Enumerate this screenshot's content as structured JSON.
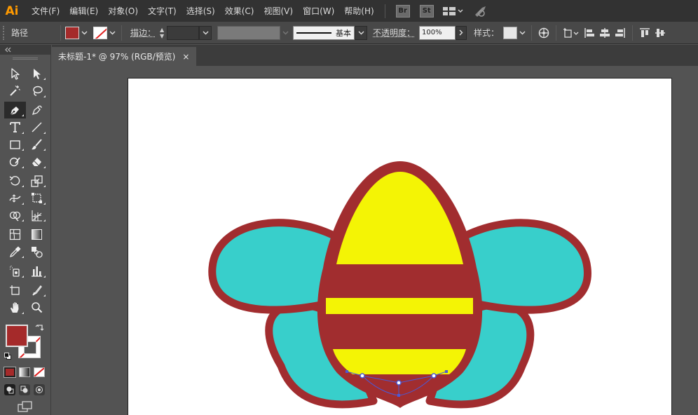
{
  "app": {
    "logo": "Ai"
  },
  "menu": {
    "items": [
      {
        "label": "文件(F)"
      },
      {
        "label": "编辑(E)"
      },
      {
        "label": "对象(O)"
      },
      {
        "label": "文字(T)"
      },
      {
        "label": "选择(S)"
      },
      {
        "label": "效果(C)"
      },
      {
        "label": "视图(V)"
      },
      {
        "label": "窗口(W)"
      },
      {
        "label": "帮助(H)"
      }
    ],
    "br": "Br",
    "st": "St"
  },
  "control": {
    "selection_type": "路径",
    "fill_color": "#a52a2a",
    "stroke_label": "描边：",
    "stroke_style": "基本",
    "opacity_label": "不透明度：",
    "opacity_value": "100%",
    "style_label": "样式："
  },
  "document": {
    "tab_title": "未标题-1* @ 97% (RGB/预览)",
    "close": "×"
  },
  "colors": {
    "fill": "#a52a2a",
    "wing": "#38cfcb",
    "body_yellow": "#f4f405",
    "outline": "#a12d2f",
    "selection": "#4a5ad8"
  },
  "tools": {
    "selected": "pen-tool"
  }
}
